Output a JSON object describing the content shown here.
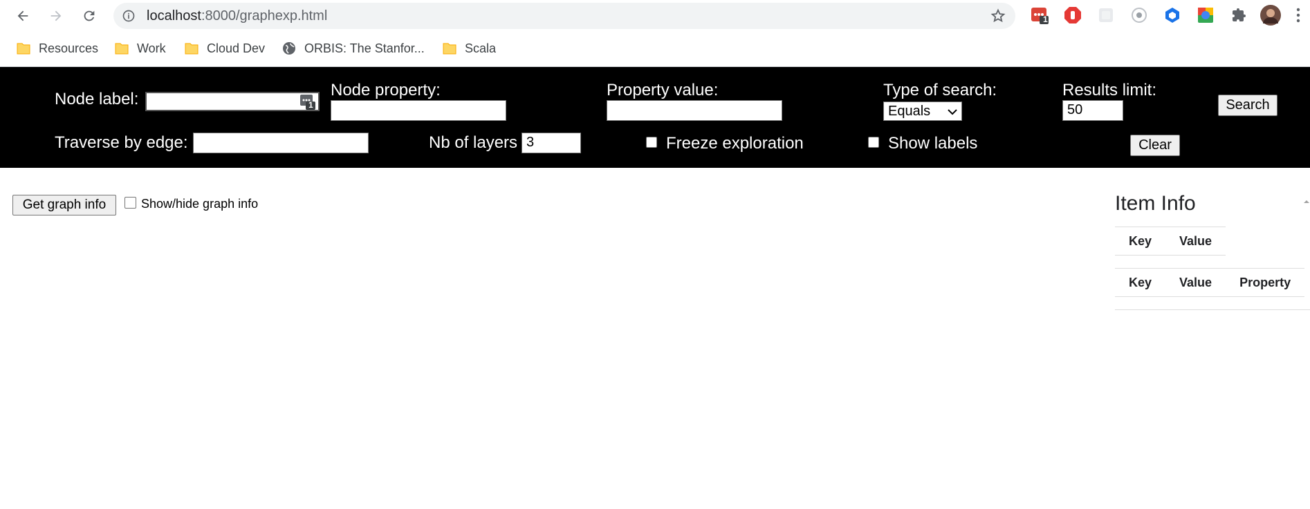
{
  "browser": {
    "url_host": "localhost",
    "url_path": ":8000/graphexp.html",
    "bookmarks": [
      {
        "label": "Resources",
        "icon": "folder-icon"
      },
      {
        "label": "Work",
        "icon": "folder-icon"
      },
      {
        "label": "Cloud Dev",
        "icon": "folder-icon"
      },
      {
        "label": "ORBIS: The Stanfor...",
        "icon": "globe-icon"
      },
      {
        "label": "Scala",
        "icon": "folder-icon"
      }
    ],
    "extension_badge": "1"
  },
  "toolbar": {
    "node_label": "Node label:",
    "node_property": "Node property:",
    "property_value": "Property value:",
    "type_of_search": "Type of search:",
    "type_of_search_value": "Equals",
    "results_limit": "Results limit:",
    "results_limit_value": "50",
    "search_button": "Search",
    "traverse_by_edge": "Traverse by edge:",
    "nb_of_layers": "Nb of layers",
    "nb_of_layers_value": "3",
    "freeze_exploration": "Freeze exploration",
    "show_labels": "Show labels",
    "clear_button": "Clear",
    "input_badge": "1"
  },
  "main": {
    "get_graph_info_button": "Get graph info",
    "show_hide_graph_info": "Show/hide graph info"
  },
  "item_info": {
    "title": "Item Info",
    "table1_headers": [
      "Key",
      "Value"
    ],
    "table2_headers": [
      "Key",
      "Value",
      "Property"
    ]
  },
  "colors": {
    "toolbar_bg": "#000000",
    "toolbar_text": "#ffffff"
  }
}
